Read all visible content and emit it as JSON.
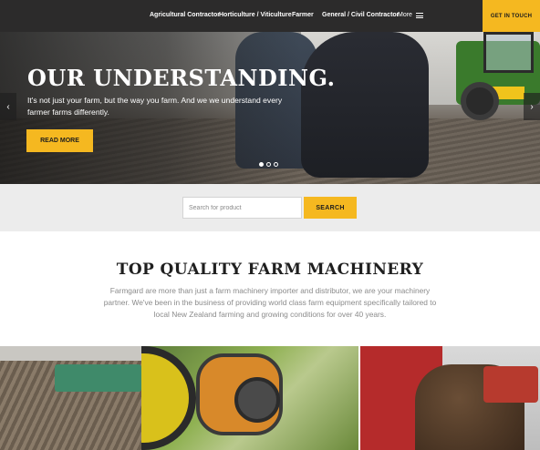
{
  "header": {
    "nav": [
      {
        "label": "Agricultural Contractor"
      },
      {
        "label": "Horticulture / Viticulture"
      },
      {
        "label": "Farmer"
      },
      {
        "label": "General / Civil Contractor"
      }
    ],
    "more_label": "More",
    "cta_label": "GET IN TOUCH"
  },
  "hero": {
    "title": "OUR UNDERSTANDING.",
    "text": "It's not just your farm, but the way you farm. And we we understand every farmer farms differently.",
    "button_label": "READ MORE",
    "prev_arrow": "‹",
    "next_arrow": "›",
    "slides": 3,
    "active_slide": 1
  },
  "search": {
    "placeholder": "Search for product",
    "value": "",
    "button_label": "SEARCH"
  },
  "intro": {
    "title": "TOP QUALITY FARM MACHINERY",
    "text": "Farmgard are more than just a farm machinery importer and distributor, we are your machinery partner. We've been in the business of providing world class farm equipment specifically tailored to local New Zealand farming and growing conditions for over 40 years."
  },
  "colors": {
    "accent": "#f5b820",
    "header_bg": "#2c2b2b",
    "band_bg": "#ececec"
  }
}
